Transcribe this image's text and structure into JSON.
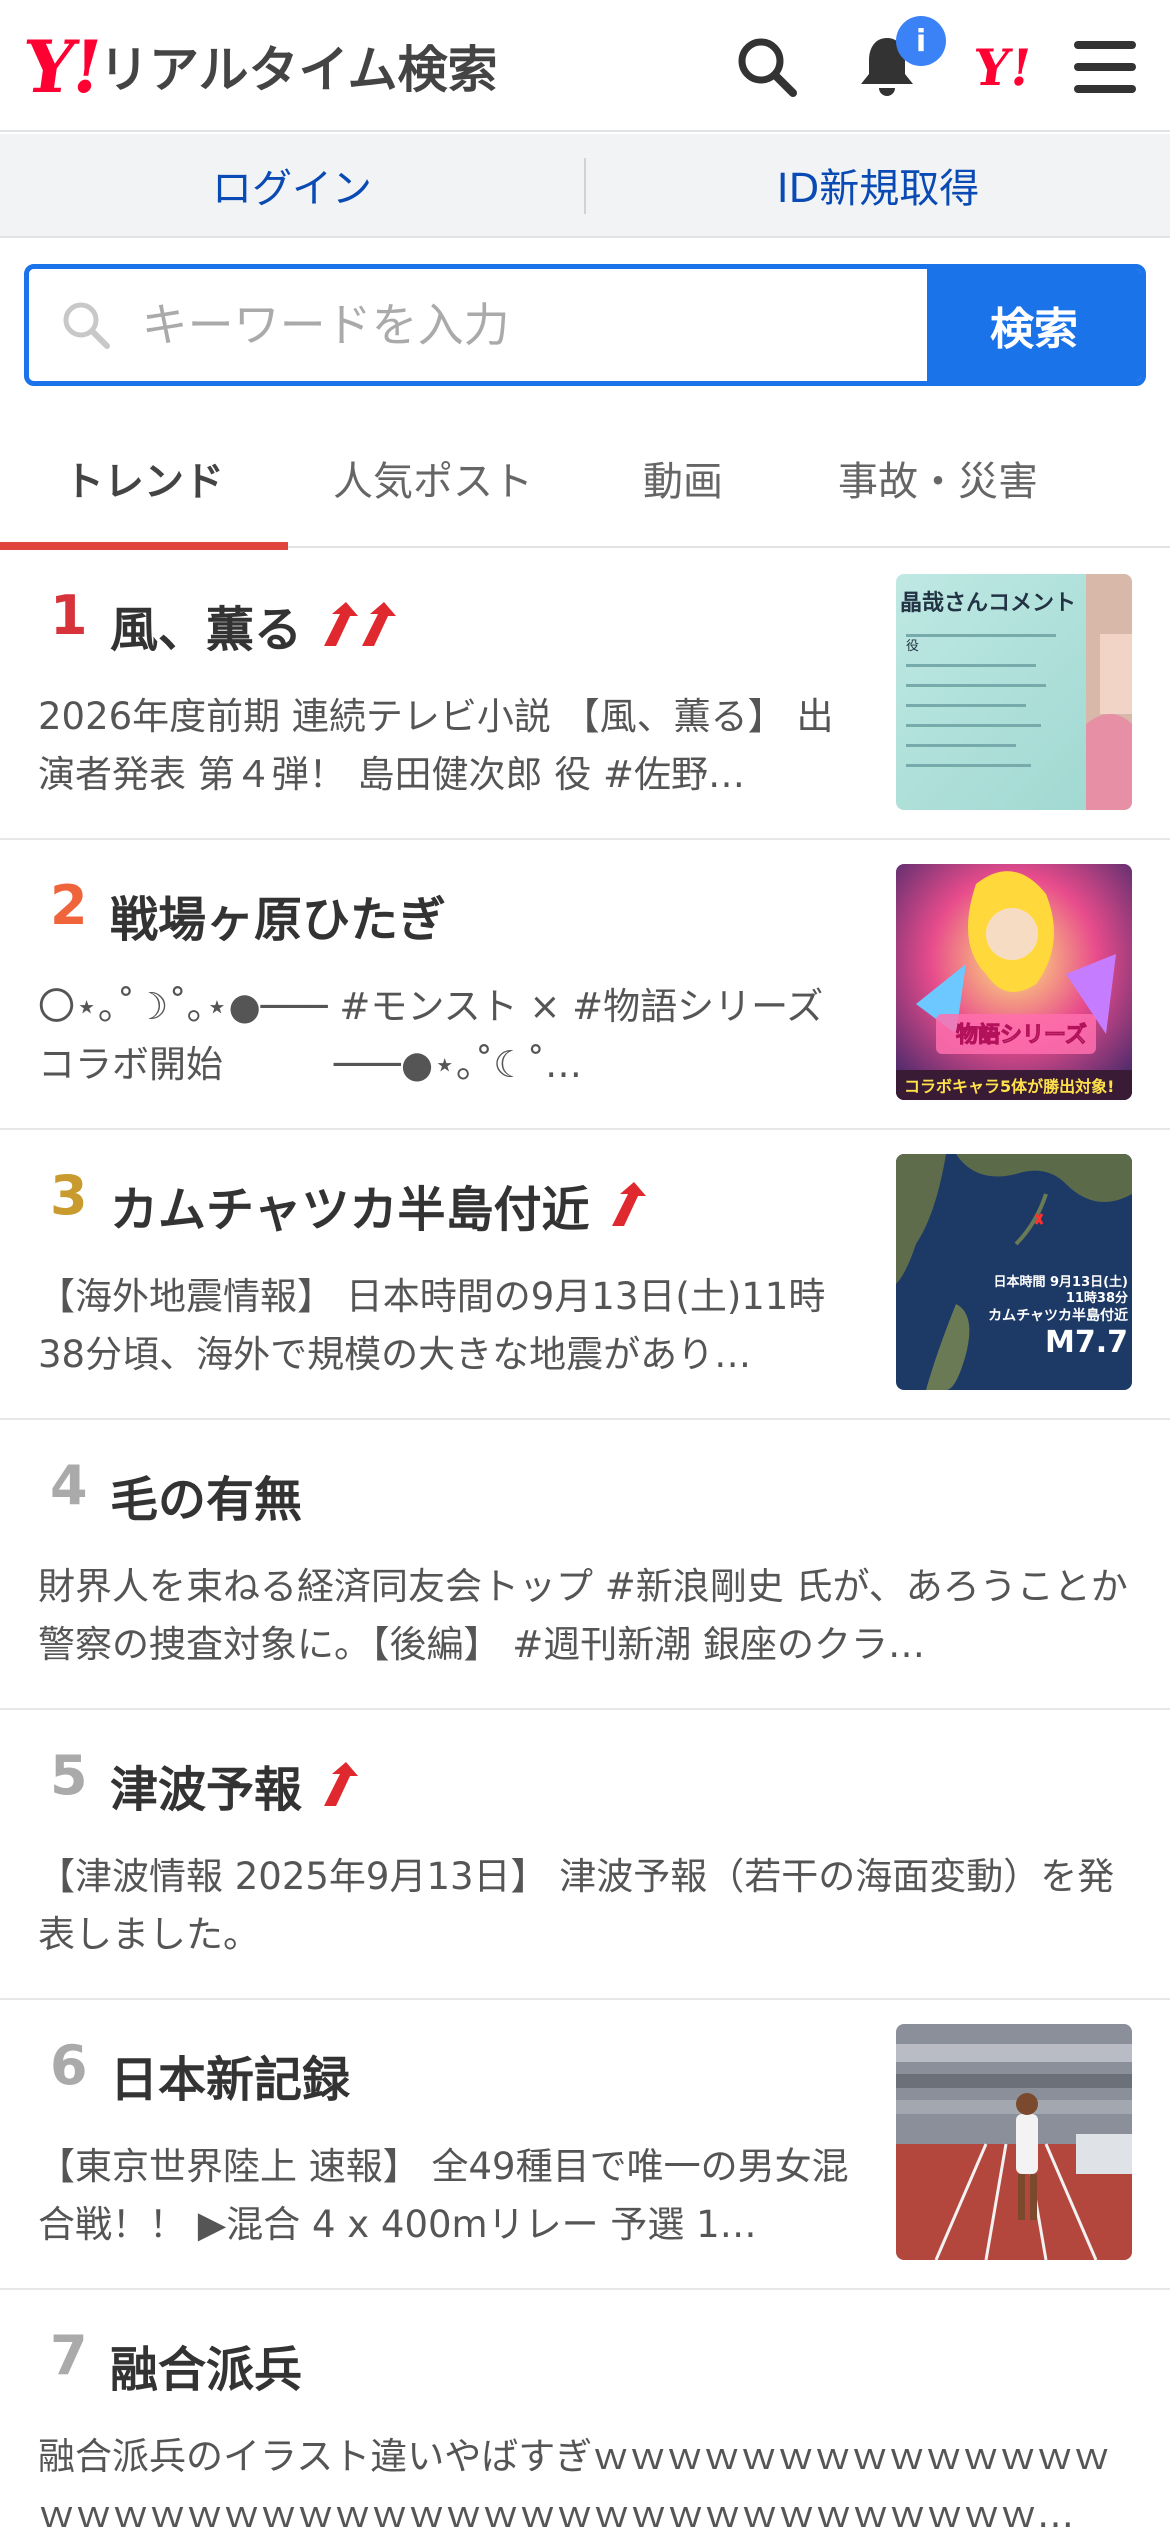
{
  "header": {
    "logo_mark": "Y!",
    "logo_text": "リアルタイム検索",
    "notification_badge": "i",
    "yj_mark": "Y!"
  },
  "loginbar": {
    "login": "ログイン",
    "signup": "ID新規取得"
  },
  "search": {
    "placeholder": "キーワードを入力",
    "button": "検索"
  },
  "tabs": [
    {
      "label": "トレンド",
      "active": true
    },
    {
      "label": "人気ポスト",
      "active": false
    },
    {
      "label": "動画",
      "active": false
    },
    {
      "label": "事故・災害",
      "active": false
    }
  ],
  "colors": {
    "brand": "#ff0033",
    "accent": "#1a73e8",
    "tab_underline": "#e0463d",
    "rank_1": "#d7333b",
    "rank_2": "#f0643c",
    "rank_3": "#c99a2e",
    "rank_other": "#aaaaaa",
    "arrow": "#e0292f"
  },
  "trends": [
    {
      "rank": "1",
      "title": "風、薫る",
      "arrows": 2,
      "desc": "2026年度前期 連続テレビ小説 【風、薫る】 出演者発表 第４弾！ 島田健次郎 役 #佐野…",
      "thumb": "drama-comment-image",
      "thumb_texts": [
        "晶哉さんコメント",
        "役"
      ]
    },
    {
      "rank": "2",
      "title": "戦場ヶ原ひたぎ",
      "arrows": 0,
      "desc": "〇⋆｡˚☽˚｡⋆●─── #モンスト × #物語シリーズ　　　コラボ開始　　　───●⋆｡˚☾˚…",
      "thumb": "monst-collab-image",
      "thumb_texts": [
        "物語シリーズ",
        "コラボキャラ5体が勝出対象!"
      ]
    },
    {
      "rank": "3",
      "title": "カムチャツカ半島付近",
      "arrows": 1,
      "desc": "【海外地震情報】 日本時間の9月13日(土)11時38分頃、海外で規模の大きな地震があり…",
      "thumb": "earthquake-map-image",
      "thumb_texts": [
        "日本時間 9月13日(土)",
        "11時38分",
        "カムチャツカ半島付近",
        "M7.7"
      ]
    },
    {
      "rank": "4",
      "title": "毛の有無",
      "arrows": 0,
      "desc": "財界人を束ねる経済同友会トップ #新浪剛史 氏が、あろうことか警察の捜査対象に。【後編】 #週刊新潮 銀座のクラ…",
      "thumb": "",
      "thumb_texts": []
    },
    {
      "rank": "5",
      "title": "津波予報",
      "arrows": 1,
      "desc": "【津波情報 2025年9月13日】 津波予報（若干の海面変動）を発表しました。",
      "thumb": "",
      "thumb_texts": []
    },
    {
      "rank": "6",
      "title": "日本新記録",
      "arrows": 0,
      "desc": "【東京世界陸上 速報】 全49種目で唯一の男女混合戦！！ ▶混合 4 x 400mリレー 予選 1…",
      "thumb": "athletics-stadium-image",
      "thumb_texts": []
    },
    {
      "rank": "7",
      "title": "融合派兵",
      "arrows": 0,
      "desc": "融合派兵のイラスト違いやばすぎｗｗｗｗｗｗｗｗｗｗｗｗｗｗｗｗｗｗｗｗｗｗｗｗｗｗｗｗｗｗｗｗｗｗｗｗｗｗｗｗｗ…",
      "thumb": "",
      "thumb_texts": []
    }
  ]
}
